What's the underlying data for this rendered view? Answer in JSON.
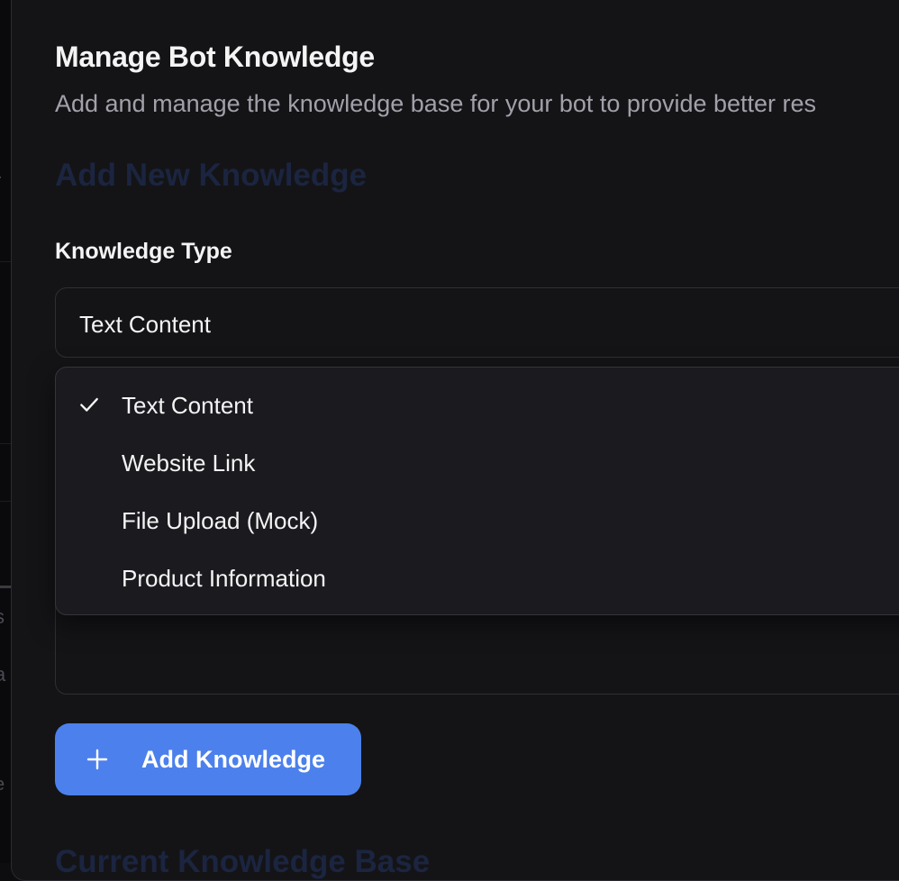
{
  "background": {
    "fragments": [
      "r",
      "s",
      "a",
      "e"
    ]
  },
  "modal": {
    "title": "Manage Bot Knowledge",
    "subtitle": "Add and manage the knowledge base for your bot to provide better res",
    "section_add_heading": "Add New Knowledge",
    "section_current_heading": "Current Knowledge Base"
  },
  "knowledge_type": {
    "label": "Knowledge Type",
    "selected_value": "Text Content",
    "options": [
      {
        "label": "Text Content",
        "selected": true
      },
      {
        "label": "Website Link",
        "selected": false
      },
      {
        "label": "File Upload (Mock)",
        "selected": false
      },
      {
        "label": "Product Information",
        "selected": false
      }
    ]
  },
  "actions": {
    "add_button_label": "Add Knowledge",
    "add_button_icon": "plus-icon"
  },
  "colors": {
    "accent": "#4c80ec",
    "surface": "#141417",
    "popover": "#1b1b1f",
    "muted_text": "#a1a1aa",
    "faded_heading": "#1b2540"
  }
}
